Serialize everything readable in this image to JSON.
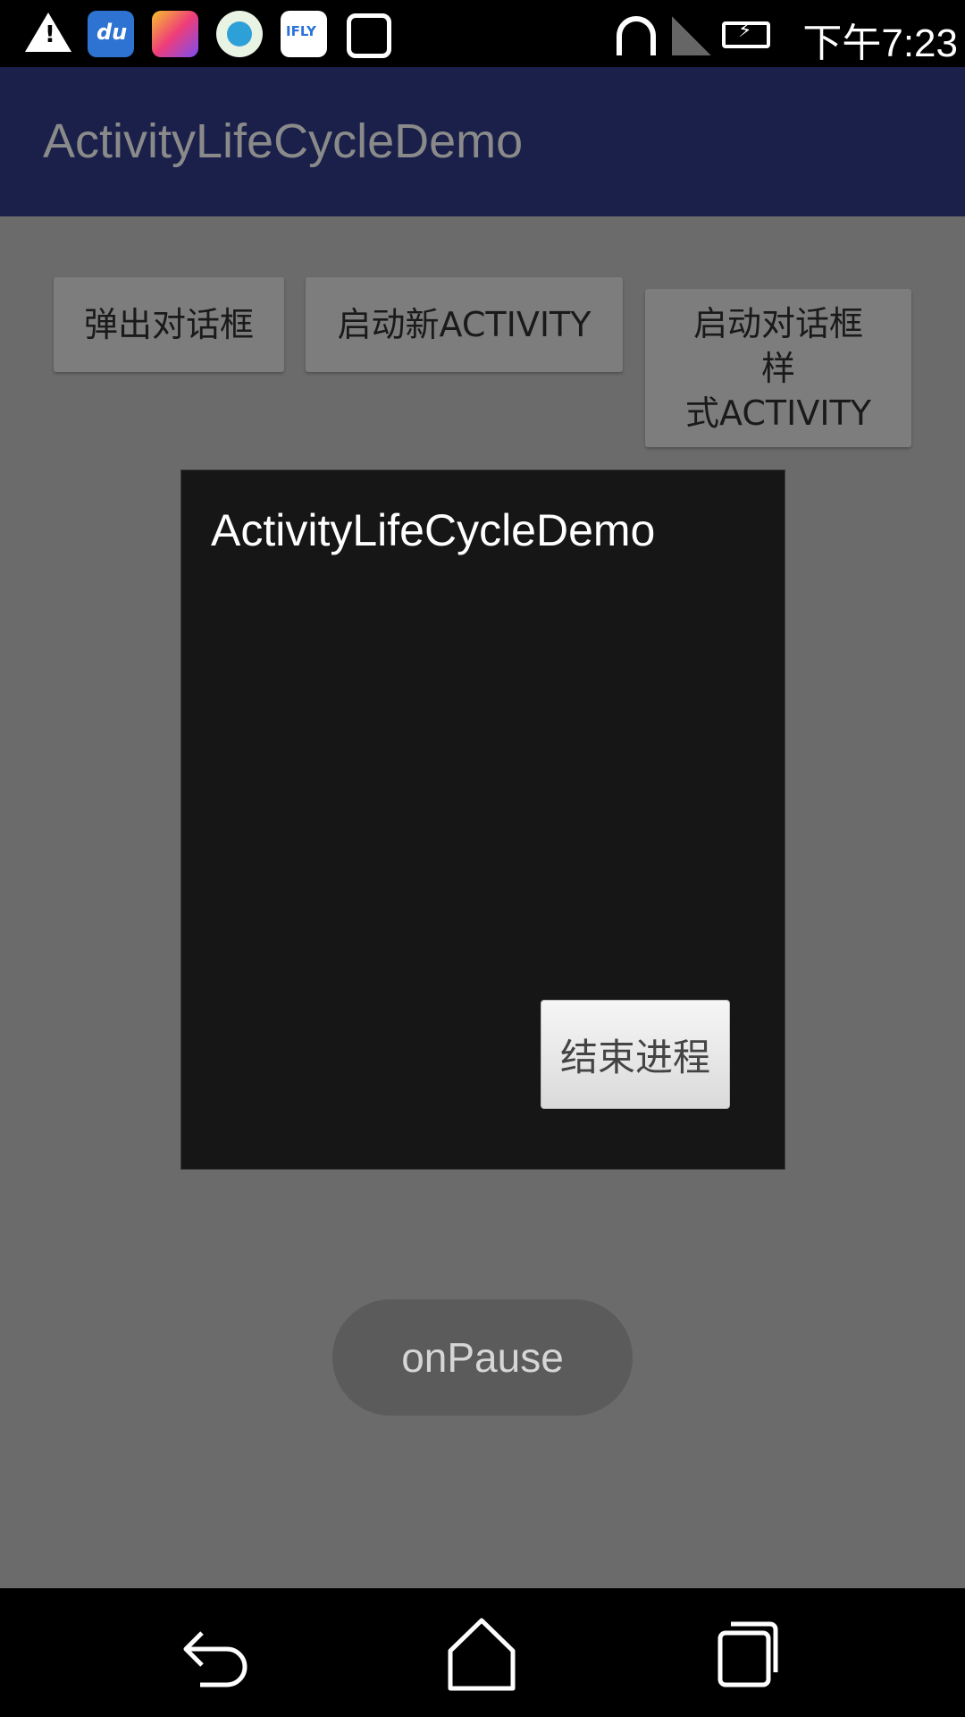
{
  "status_bar": {
    "time": "下午7:23",
    "notification_icons": [
      "warning-icon",
      "du-icon",
      "brush-app-icon",
      "eye-app-icon",
      "ifly-icon",
      "bear-app-icon"
    ],
    "ifly_label": "IFLY",
    "du_label": "du",
    "system_icons": [
      "wifi-icon",
      "no-signal-icon",
      "battery-charging-icon"
    ]
  },
  "toolbar": {
    "title": "ActivityLifeCycleDemo",
    "background": "#1a2049"
  },
  "buttons": {
    "show_dialog": "弹出对话框",
    "start_activity": "启动新ACTIVITY",
    "start_dialog_activity": "启动对话框\n样\n式ACTIVITY"
  },
  "dialog": {
    "title": "ActivityLifeCycleDemo",
    "button_label": "结束进程"
  },
  "toast": {
    "text": "onPause"
  },
  "nav_bar": {
    "items": [
      "back-icon",
      "home-icon",
      "recent-apps-icon"
    ]
  }
}
